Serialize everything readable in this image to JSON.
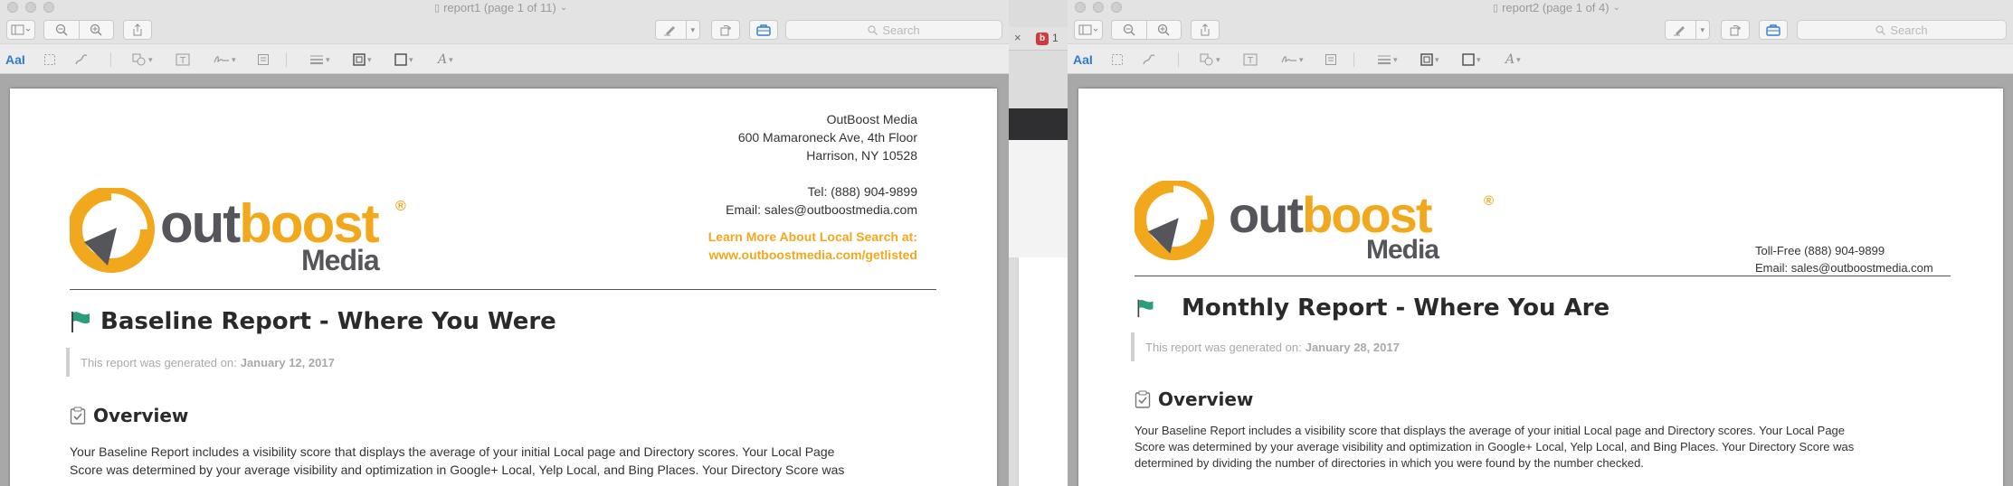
{
  "window1": {
    "title": "report1 (page 1 of 11)",
    "search_placeholder": "Search",
    "company": {
      "name": "OutBoost Media",
      "address1": "600 Mamaroneck Ave, 4th Floor",
      "address2": "Harrison, NY 10528",
      "phone": "Tel: (888) 904-9899",
      "email": "Email: sales@outboostmedia.com",
      "learn_more": "Learn More About Local Search at:",
      "learn_url": "www.outboostmedia.com/getlisted"
    },
    "logo": {
      "word_gray": "out",
      "word_orange": "boost",
      "reg": "®",
      "sub": "Media"
    },
    "report_title": "Baseline Report - Where You Were",
    "generated_label": "This report was generated on:",
    "generated_date": "January 12, 2017",
    "section_title": "Overview",
    "overview_line1": "Your Baseline Report includes a visibility score that displays the average of your initial Local page and Directory scores. Your Local Page",
    "overview_line2": "Score was determined by your average visibility and optimization in Google+ Local, Yelp Local, and Bing Places. Your Directory Score was"
  },
  "window2": {
    "title": "report2 (page 1 of 4)",
    "search_placeholder": "Search",
    "contact": {
      "tollfree": "Toll-Free (888) 904-9899",
      "email": "Email: sales@outboostmedia.com"
    },
    "logo": {
      "word_gray": "out",
      "word_orange": "boost",
      "reg": "®",
      "sub": "Media"
    },
    "report_title": "Monthly Report - Where You Are",
    "generated_label": "This report was generated on:",
    "generated_date": "January 28, 2017",
    "section_title": "Overview",
    "overview_line1": "Your Baseline Report includes a visibility score that displays the average of your initial Local page and Directory scores. Your Local Page",
    "overview_line2": "Score was determined by your average visibility and optimization in Google+ Local, Yelp Local, and Bing Places. Your Directory Score was",
    "overview_line3": "determined by dividing the number of directories in which you were found by the number checked."
  },
  "markup_toolbar": {
    "text_style_label": "AaI"
  },
  "background_window": {
    "tab_close": "×",
    "tab_favicon": "b",
    "tab_text": "1"
  },
  "colors": {
    "brand_orange": "#f2a81d",
    "brand_gray": "#55555c",
    "accent_blue": "#2d7bd6",
    "flag_green": "#2a9d7d"
  }
}
